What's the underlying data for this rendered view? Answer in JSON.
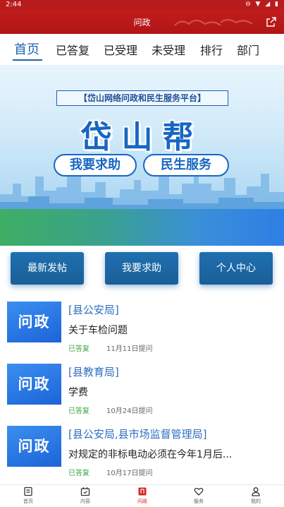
{
  "status_bar": {
    "time": "2:44",
    "icons": "⊖ ▼ ◢ ▮"
  },
  "header": {
    "title": "问政"
  },
  "tabs": [
    {
      "label": "首页",
      "active": true
    },
    {
      "label": "已答复"
    },
    {
      "label": "已受理"
    },
    {
      "label": "未受理"
    },
    {
      "label": "排行"
    },
    {
      "label": "部门"
    }
  ],
  "banner": {
    "subtitle": "【岱山网络问政和民生服务平台】",
    "title": "岱山帮",
    "pill_1": "我要求助",
    "pill_2": "民生服务"
  },
  "actions": {
    "latest": "最新发帖",
    "help": "我要求助",
    "profile": "个人中心"
  },
  "list": [
    {
      "thumb": "问政",
      "dept": "[县公安局]",
      "subject": "关于车检问题",
      "status": "已答复",
      "date": "11月11日提问"
    },
    {
      "thumb": "问政",
      "dept": "[县教育局]",
      "subject": "学费",
      "status": "已答复",
      "date": "10月24日提问"
    },
    {
      "thumb": "问政",
      "dept": "[县公安局,县市场监督管理局]",
      "subject": "对规定的非标电动必须在今年1月后...",
      "status": "已答复",
      "date": "10月17日提问"
    }
  ],
  "bottom_nav": [
    {
      "label": "首页",
      "icon": "document-icon"
    },
    {
      "label": "内容",
      "icon": "calendar-icon"
    },
    {
      "label": "问政",
      "icon": "wenzheng-icon",
      "active": true
    },
    {
      "label": "服务",
      "icon": "heart-icon"
    },
    {
      "label": "我的",
      "icon": "user-icon"
    }
  ],
  "colors": {
    "brand_red": "#b81c1c",
    "tab_blue": "#1e63b3",
    "button_blue": "#1a5f98",
    "answered_green": "#3aa63e"
  }
}
